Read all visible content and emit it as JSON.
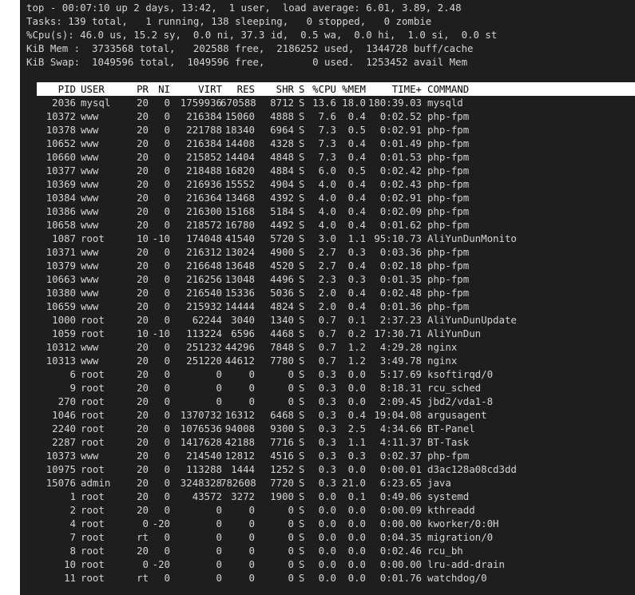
{
  "summary": {
    "line1": "top - 00:07:10 up 2 days, 13:42,  1 user,  load average: 6.01, 3.89, 2.48",
    "line2": "Tasks: 139 total,   1 running, 138 sleeping,   0 stopped,   0 zombie",
    "line3": "%Cpu(s): 46.0 us, 15.2 sy,  0.0 ni, 37.3 id,  0.5 wa,  0.0 hi,  1.0 si,  0.0 st",
    "line4": "KiB Mem :  3733568 total,   202588 free,  2186252 used,  1344728 buff/cache",
    "line5": "KiB Swap:  1049596 total,  1049596 free,        0 used.  1253452 avail Mem"
  },
  "columns": {
    "pid": "PID",
    "user": "USER",
    "pr": "PR",
    "ni": "NI",
    "virt": "VIRT",
    "res": "RES",
    "shr": "SHR",
    "s": "S",
    "cpu": "%CPU",
    "mem": "%MEM",
    "time": "TIME+",
    "command": "COMMAND"
  },
  "processes": [
    [
      "2036",
      "mysql",
      "20",
      "0",
      "1759936",
      "670588",
      "8712",
      "S",
      "13.6",
      "18.0",
      "180:39.03",
      "mysqld"
    ],
    [
      "10372",
      "www",
      "20",
      "0",
      "216384",
      "15060",
      "4888",
      "S",
      "7.6",
      "0.4",
      "0:02.52",
      "php-fpm"
    ],
    [
      "10378",
      "www",
      "20",
      "0",
      "221788",
      "18340",
      "6964",
      "S",
      "7.3",
      "0.5",
      "0:02.91",
      "php-fpm"
    ],
    [
      "10652",
      "www",
      "20",
      "0",
      "216384",
      "14408",
      "4328",
      "S",
      "7.3",
      "0.4",
      "0:01.49",
      "php-fpm"
    ],
    [
      "10660",
      "www",
      "20",
      "0",
      "215852",
      "14404",
      "4848",
      "S",
      "7.3",
      "0.4",
      "0:01.53",
      "php-fpm"
    ],
    [
      "10377",
      "www",
      "20",
      "0",
      "218488",
      "16820",
      "4884",
      "S",
      "6.0",
      "0.5",
      "0:02.42",
      "php-fpm"
    ],
    [
      "10369",
      "www",
      "20",
      "0",
      "216936",
      "15552",
      "4904",
      "S",
      "4.0",
      "0.4",
      "0:02.43",
      "php-fpm"
    ],
    [
      "10384",
      "www",
      "20",
      "0",
      "216364",
      "13468",
      "4392",
      "S",
      "4.0",
      "0.4",
      "0:02.91",
      "php-fpm"
    ],
    [
      "10386",
      "www",
      "20",
      "0",
      "216300",
      "15168",
      "5184",
      "S",
      "4.0",
      "0.4",
      "0:02.09",
      "php-fpm"
    ],
    [
      "10658",
      "www",
      "20",
      "0",
      "218572",
      "16780",
      "4492",
      "S",
      "4.0",
      "0.4",
      "0:01.62",
      "php-fpm"
    ],
    [
      "1087",
      "root",
      "10",
      "-10",
      "174048",
      "41540",
      "5720",
      "S",
      "3.0",
      "1.1",
      "95:10.73",
      "AliYunDunMonito"
    ],
    [
      "10371",
      "www",
      "20",
      "0",
      "216312",
      "13024",
      "4900",
      "S",
      "2.7",
      "0.3",
      "0:03.36",
      "php-fpm"
    ],
    [
      "10379",
      "www",
      "20",
      "0",
      "216648",
      "13648",
      "4520",
      "S",
      "2.7",
      "0.4",
      "0:02.18",
      "php-fpm"
    ],
    [
      "10663",
      "www",
      "20",
      "0",
      "216256",
      "13048",
      "4496",
      "S",
      "2.3",
      "0.3",
      "0:01.35",
      "php-fpm"
    ],
    [
      "10380",
      "www",
      "20",
      "0",
      "216540",
      "15336",
      "5036",
      "S",
      "2.0",
      "0.4",
      "0:02.48",
      "php-fpm"
    ],
    [
      "10659",
      "www",
      "20",
      "0",
      "215932",
      "14444",
      "4824",
      "S",
      "2.0",
      "0.4",
      "0:01.36",
      "php-fpm"
    ],
    [
      "1000",
      "root",
      "20",
      "0",
      "62244",
      "3040",
      "1340",
      "S",
      "0.7",
      "0.1",
      "2:37.23",
      "AliYunDunUpdate"
    ],
    [
      "1059",
      "root",
      "10",
      "-10",
      "113224",
      "6596",
      "4468",
      "S",
      "0.7",
      "0.2",
      "17:30.71",
      "AliYunDun"
    ],
    [
      "10312",
      "www",
      "20",
      "0",
      "251232",
      "44296",
      "7848",
      "S",
      "0.7",
      "1.2",
      "4:29.28",
      "nginx"
    ],
    [
      "10313",
      "www",
      "20",
      "0",
      "251220",
      "44612",
      "7780",
      "S",
      "0.7",
      "1.2",
      "3:49.78",
      "nginx"
    ],
    [
      "6",
      "root",
      "20",
      "0",
      "0",
      "0",
      "0",
      "S",
      "0.3",
      "0.0",
      "5:17.69",
      "ksoftirqd/0"
    ],
    [
      "9",
      "root",
      "20",
      "0",
      "0",
      "0",
      "0",
      "S",
      "0.3",
      "0.0",
      "8:18.31",
      "rcu_sched"
    ],
    [
      "270",
      "root",
      "20",
      "0",
      "0",
      "0",
      "0",
      "S",
      "0.3",
      "0.0",
      "2:09.45",
      "jbd2/vda1-8"
    ],
    [
      "1046",
      "root",
      "20",
      "0",
      "1370732",
      "16312",
      "6468",
      "S",
      "0.3",
      "0.4",
      "19:04.08",
      "argusagent"
    ],
    [
      "2240",
      "root",
      "20",
      "0",
      "1076536",
      "94008",
      "9300",
      "S",
      "0.3",
      "2.5",
      "4:34.66",
      "BT-Panel"
    ],
    [
      "2287",
      "root",
      "20",
      "0",
      "1417628",
      "42188",
      "7716",
      "S",
      "0.3",
      "1.1",
      "4:11.37",
      "BT-Task"
    ],
    [
      "10373",
      "www",
      "20",
      "0",
      "214540",
      "12812",
      "4516",
      "S",
      "0.3",
      "0.3",
      "0:02.37",
      "php-fpm"
    ],
    [
      "10975",
      "root",
      "20",
      "0",
      "113288",
      "1444",
      "1252",
      "S",
      "0.3",
      "0.0",
      "0:00.01",
      "d3ac128a08cd3dd"
    ],
    [
      "15076",
      "admin",
      "20",
      "0",
      "3248328",
      "782608",
      "7720",
      "S",
      "0.3",
      "21.0",
      "6:23.65",
      "java"
    ],
    [
      "1",
      "root",
      "20",
      "0",
      "43572",
      "3272",
      "1900",
      "S",
      "0.0",
      "0.1",
      "0:49.06",
      "systemd"
    ],
    [
      "2",
      "root",
      "20",
      "0",
      "0",
      "0",
      "0",
      "S",
      "0.0",
      "0.0",
      "0:00.09",
      "kthreadd"
    ],
    [
      "4",
      "root",
      "0",
      "-20",
      "0",
      "0",
      "0",
      "S",
      "0.0",
      "0.0",
      "0:00.00",
      "kworker/0:0H"
    ],
    [
      "7",
      "root",
      "rt",
      "0",
      "0",
      "0",
      "0",
      "S",
      "0.0",
      "0.0",
      "0:04.35",
      "migration/0"
    ],
    [
      "8",
      "root",
      "20",
      "0",
      "0",
      "0",
      "0",
      "S",
      "0.0",
      "0.0",
      "0:02.46",
      "rcu_bh"
    ],
    [
      "10",
      "root",
      "0",
      "-20",
      "0",
      "0",
      "0",
      "S",
      "0.0",
      "0.0",
      "0:00.00",
      "lru-add-drain"
    ],
    [
      "11",
      "root",
      "rt",
      "0",
      "0",
      "0",
      "0",
      "S",
      "0.0",
      "0.0",
      "0:01.76",
      "watchdog/0"
    ]
  ],
  "colors": {
    "background": "#1e1e1e",
    "foreground": "#d4d4d4",
    "header_background": "#ffffff",
    "header_foreground": "#000000"
  }
}
